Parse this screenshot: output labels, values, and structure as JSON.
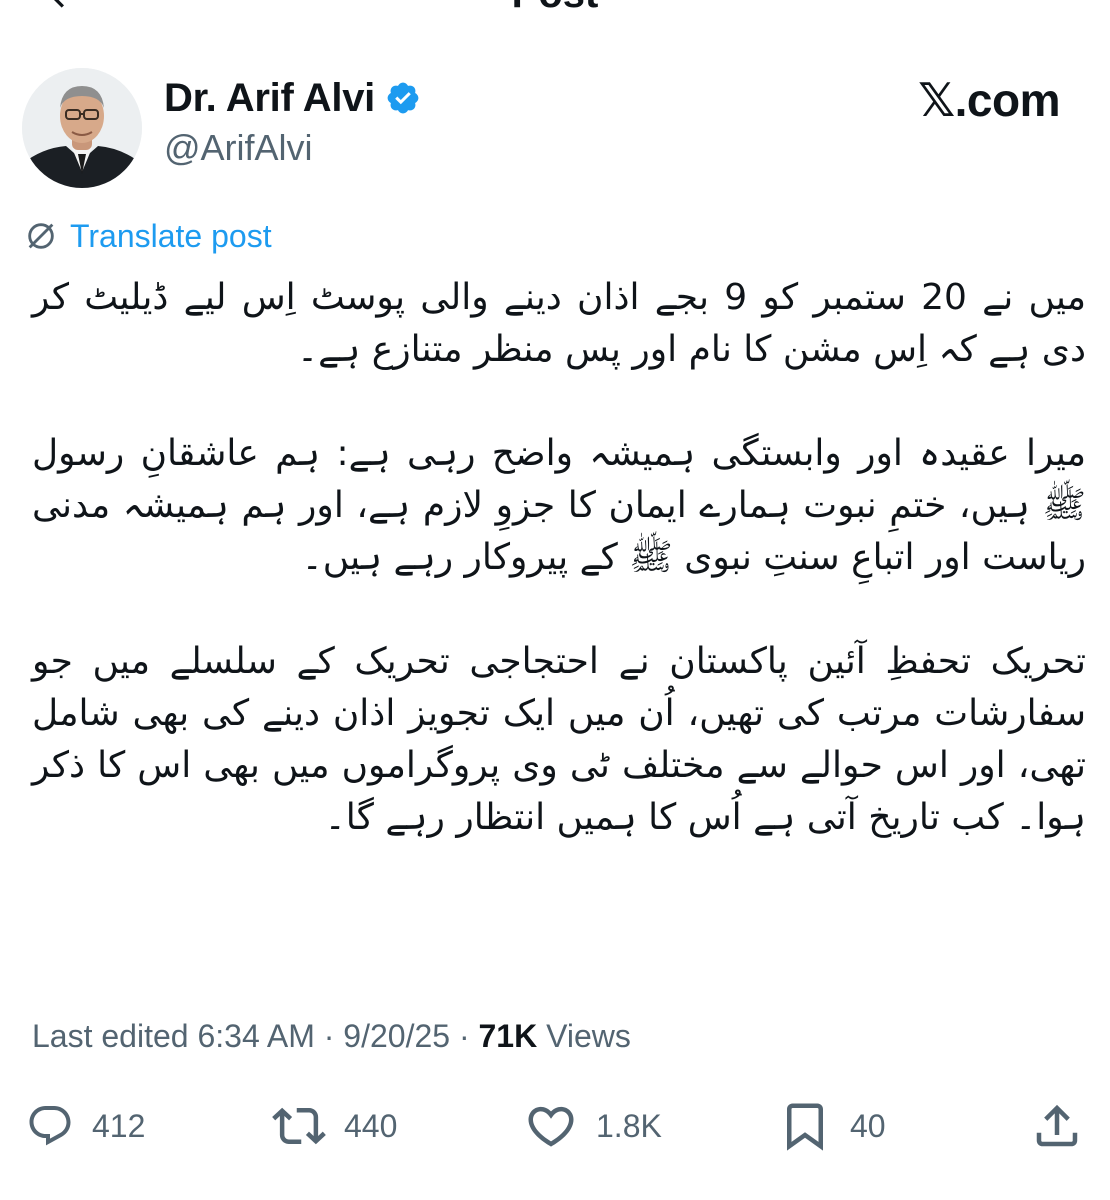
{
  "header": {
    "title": "Post"
  },
  "author": {
    "display_name": "Dr. Arif Alvi",
    "handle": "@ArifAlvi",
    "verified_color": "#1d9bf0"
  },
  "brand": {
    "label": "𝕏.com"
  },
  "translate": {
    "label": "Translate post",
    "icon": "translate-icon"
  },
  "post": {
    "paragraph_1": "میں نے 20 ستمبر کو 9 بجے اذان دینے والی پوسٹ اِس لیے ڈیلیٹ کر دی ہے کہ اِس مشن کا نام اور پس منظر متنازع ہے۔",
    "paragraph_2": "میرا عقیدہ اور وابستگی ہمیشہ واضح رہی ہے: ہم عاشقانِ رسول ﷺ ہیں، ختمِ نبوت ہمارے ایمان کا جزوِ لازم ہے، اور ہم ہمیشہ مدنی ریاست اور اتباعِ سنتِ نبوی ﷺ کے پیروکار رہے ہیں۔",
    "paragraph_3": "تحریک تحفظِ آئین پاکستان نے احتجاجی تحریک کے سلسلے میں جو سفارشات مرتب کی تھیں، اُن میں ایک تجویز اذان دینے کی بھی شامل تھی، اور اس حوالے سے مختلف ٹی وی پروگراموں میں بھی اس کا ذکر ہوا۔ کب تاریخ آتی ہے اُس کا ہمیں انتظار رہے گا۔"
  },
  "meta": {
    "edited": "Last edited 6:34 AM · 9/20/25 · ",
    "views_count": "71K",
    "views_label": " Views"
  },
  "actions": {
    "replies": "412",
    "reposts": "440",
    "likes": "1.8K",
    "bookmarks": "40"
  },
  "colors": {
    "accent": "#1d9bf0",
    "text": "#0f1419",
    "muted": "#536471"
  }
}
